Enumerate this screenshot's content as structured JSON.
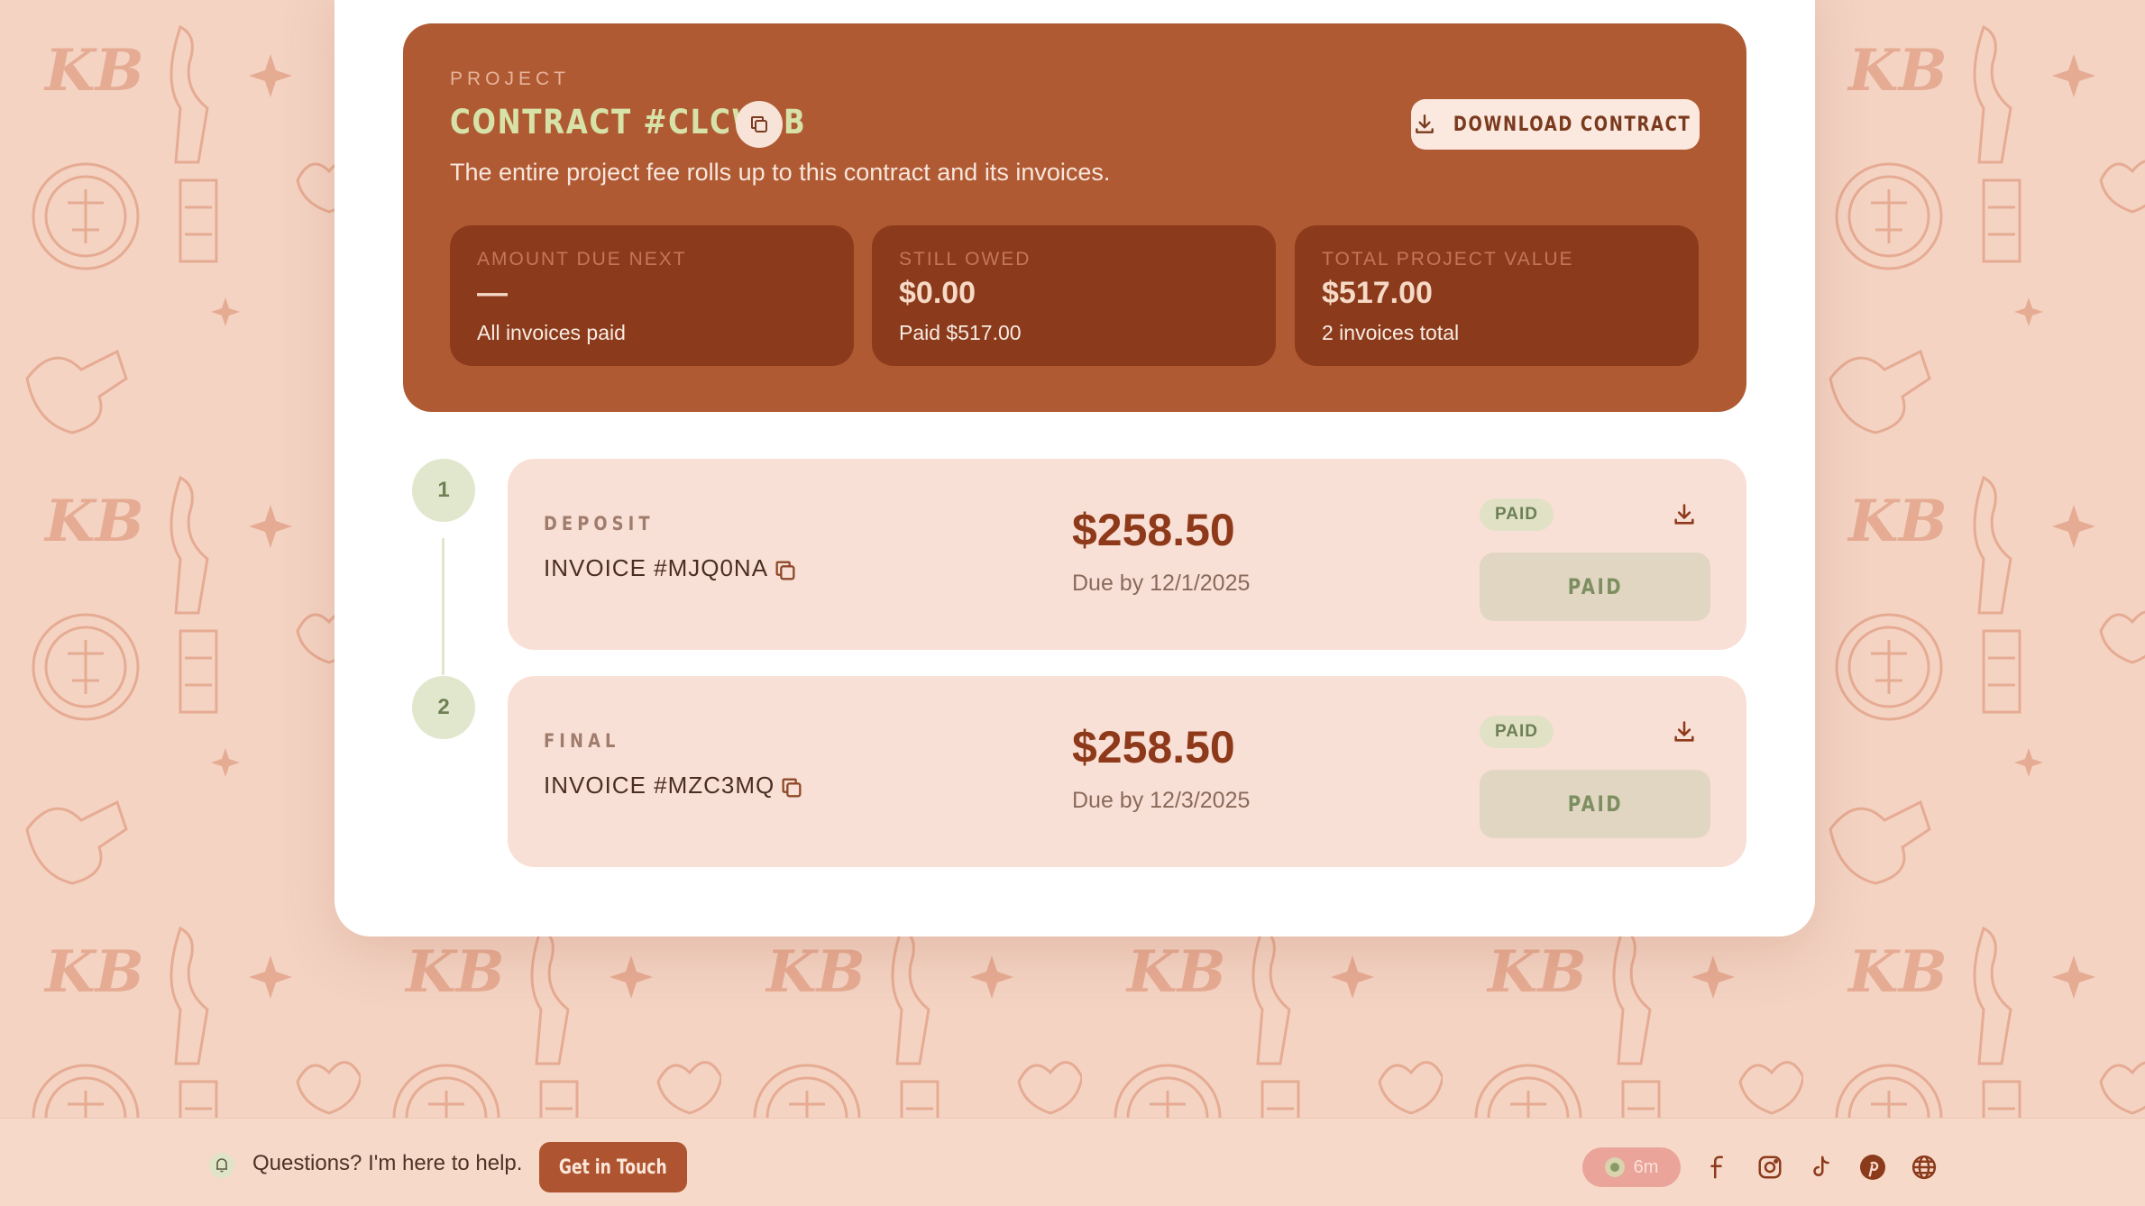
{
  "project": {
    "eyebrow": "PROJECT",
    "title": "CONTRACT #CLCWLB",
    "subtitle": "The entire project fee rolls up to this contract and its invoices.",
    "download_label": "DOWNLOAD CONTRACT",
    "stats": [
      {
        "label": "AMOUNT DUE NEXT",
        "value": "—",
        "sub": "All invoices paid"
      },
      {
        "label": "STILL OWED",
        "value": "$0.00",
        "sub": "Paid $517.00"
      },
      {
        "label": "TOTAL PROJECT VALUE",
        "value": "$517.00",
        "sub": "2 invoices total"
      }
    ]
  },
  "invoices": [
    {
      "step": "1",
      "kind": "DEPOSIT",
      "number": "INVOICE #MJQ0NA",
      "amount": "$258.50",
      "due": "Due by 12/1/2025",
      "badge": "PAID",
      "button": "PAID"
    },
    {
      "step": "2",
      "kind": "FINAL",
      "number": "INVOICE #MZC3MQ",
      "amount": "$258.50",
      "due": "Due by 12/3/2025",
      "badge": "PAID",
      "button": "PAID"
    }
  ],
  "footer": {
    "help_text": "Questions? I'm here to help.",
    "touch_label": "Get in Touch",
    "timer": "6m",
    "social_icons": [
      "facebook-icon",
      "instagram-icon",
      "tiktok-icon",
      "pinterest-icon",
      "globe-icon"
    ]
  },
  "colors": {
    "page_bg": "#f4d3c3",
    "accent": "#b05a33",
    "stat_tile": "#8b3b1c",
    "invoice_card": "#f9e0d6",
    "paid_green": "#6d7f55",
    "amount": "#8e3a1a"
  }
}
